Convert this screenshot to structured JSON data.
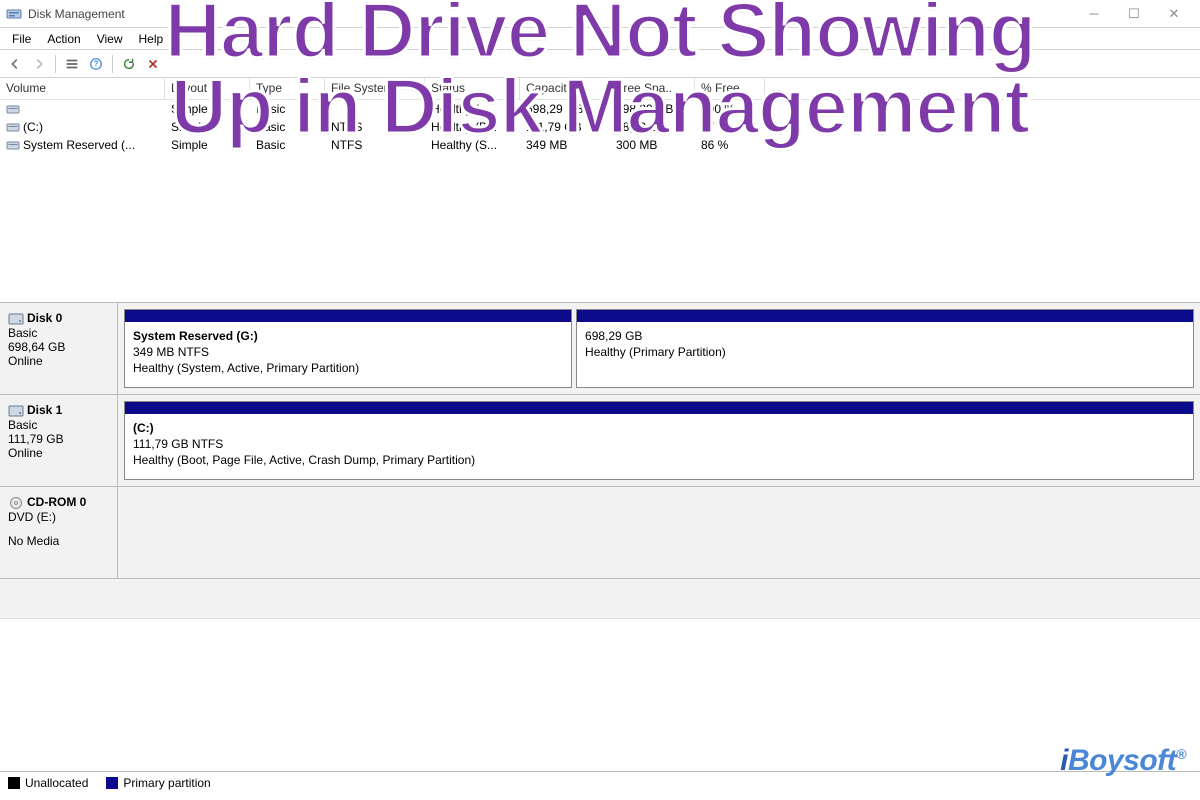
{
  "overlay": {
    "line1": "Hard Drive Not Showing",
    "line2": "Up in Disk Management"
  },
  "watermark": {
    "text": "iBoysoft",
    "tm": "®"
  },
  "titlebar": {
    "title": "Disk Management"
  },
  "menu": {
    "file": "File",
    "action": "Action",
    "view": "View",
    "help": "Help"
  },
  "toolbar_icons": [
    "back",
    "forward",
    "sep",
    "list",
    "help",
    "sep",
    "refresh",
    "delete"
  ],
  "vol_headers": {
    "volume": "Volume",
    "layout": "Layout",
    "type": "Type",
    "fs": "File System",
    "status": "Status",
    "cap": "Capacity",
    "free": "Free Spa...",
    "pct": "% Free"
  },
  "volumes": [
    {
      "name": "",
      "layout": "Simple",
      "type": "Basic",
      "fs": "",
      "status": "Healthy (...",
      "cap": "698,29 GB",
      "free": "698,29 GB",
      "pct": "100 %"
    },
    {
      "name": "(C:)",
      "layout": "Simple",
      "type": "Basic",
      "fs": "NTFS",
      "status": "Healthy (B...",
      "cap": "111,79 GB",
      "free": "18,93 GB",
      "pct": "17 %"
    },
    {
      "name": "System Reserved (...",
      "layout": "Simple",
      "type": "Basic",
      "fs": "NTFS",
      "status": "Healthy (S...",
      "cap": "349 MB",
      "free": "300 MB",
      "pct": "86 %"
    }
  ],
  "disks": [
    {
      "label": "Disk 0",
      "kind": "Basic",
      "size": "698,64 GB",
      "state": "Online",
      "icon": "hdd",
      "partitions": [
        {
          "name": "System Reserved  (G:)",
          "sub": "349 MB NTFS",
          "status": "Healthy (System, Active, Primary Partition)",
          "flex": 0.42
        },
        {
          "name": "",
          "sub": "698,29 GB",
          "status": "Healthy (Primary Partition)",
          "flex": 0.58
        }
      ]
    },
    {
      "label": "Disk 1",
      "kind": "Basic",
      "size": "111,79 GB",
      "state": "Online",
      "icon": "hdd",
      "partitions": [
        {
          "name": "(C:)",
          "sub": "111,79 GB NTFS",
          "status": "Healthy (Boot, Page File, Active, Crash Dump, Primary Partition)",
          "flex": 1
        }
      ]
    },
    {
      "label": "CD-ROM 0",
      "kind": "DVD (E:)",
      "size": "",
      "state": "No Media",
      "icon": "cd",
      "partitions": []
    }
  ],
  "legend": {
    "unallocated": "Unallocated",
    "primary": "Primary partition"
  }
}
